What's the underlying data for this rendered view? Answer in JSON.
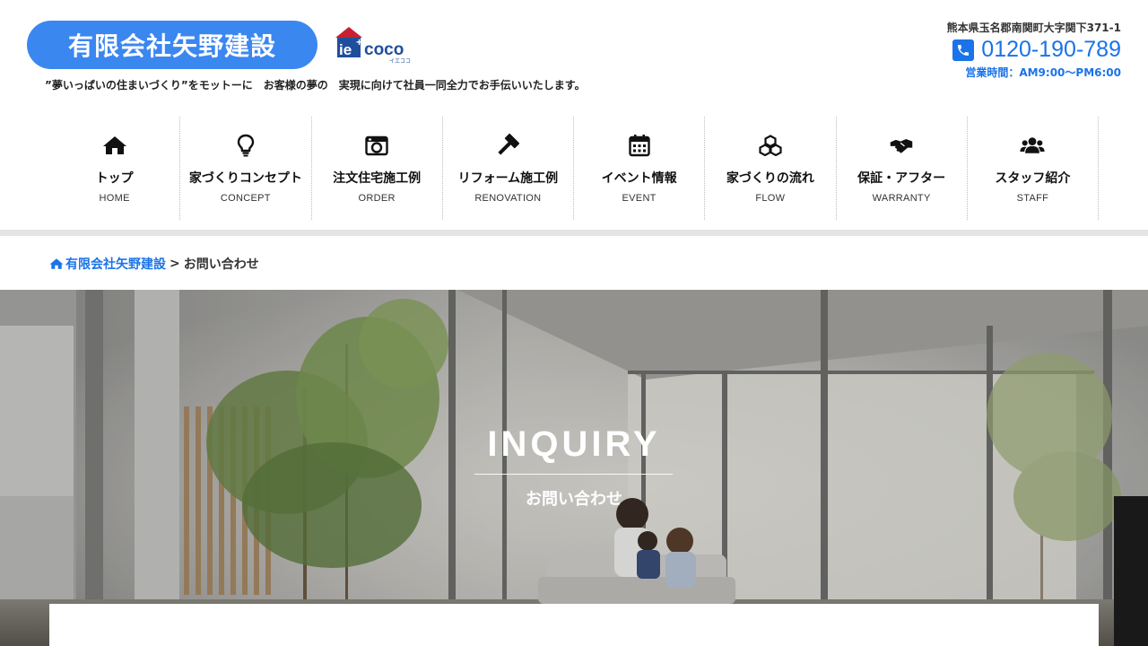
{
  "header": {
    "company_name": "有限会社矢野建設",
    "partner_logo": {
      "text": "ie coco",
      "kana": "イエココ"
    },
    "tagline": "”夢いっぱいの住まいづくり”をモットーに　お客様の夢の　実現に向けて社員一同全力でお手伝いいたします。",
    "address": "熊本県玉名郡南関町大字関下371-1",
    "phone": "0120-190-789",
    "hours": "営業時間：AM9:00～PM6:00"
  },
  "nav": {
    "items": [
      {
        "label": "トップ",
        "sub": "HOME",
        "icon": "home-icon"
      },
      {
        "label": "家づくりコンセプト",
        "sub": "CONCEPT",
        "icon": "lightbulb-icon"
      },
      {
        "label": "注文住宅施工例",
        "sub": "ORDER",
        "icon": "camera-icon"
      },
      {
        "label": "リフォーム施工例",
        "sub": "RENOVATION",
        "icon": "hammer-icon"
      },
      {
        "label": "イベント情報",
        "sub": "EVENT",
        "icon": "calendar-icon"
      },
      {
        "label": "家づくりの流れ",
        "sub": "FLOW",
        "icon": "cubes-icon"
      },
      {
        "label": "保証・アフター",
        "sub": "WARRANTY",
        "icon": "handshake-icon"
      },
      {
        "label": "スタッフ紹介",
        "sub": "STAFF",
        "icon": "users-icon"
      }
    ]
  },
  "breadcrumb": {
    "home": "有限会社矢野建設",
    "separator": ">",
    "current": "お問い合わせ"
  },
  "hero": {
    "title": "INQUIRY",
    "subtitle": "お問い合わせ"
  },
  "colors": {
    "brand_blue": "#3b87f0",
    "link_blue": "#1a73e8"
  }
}
